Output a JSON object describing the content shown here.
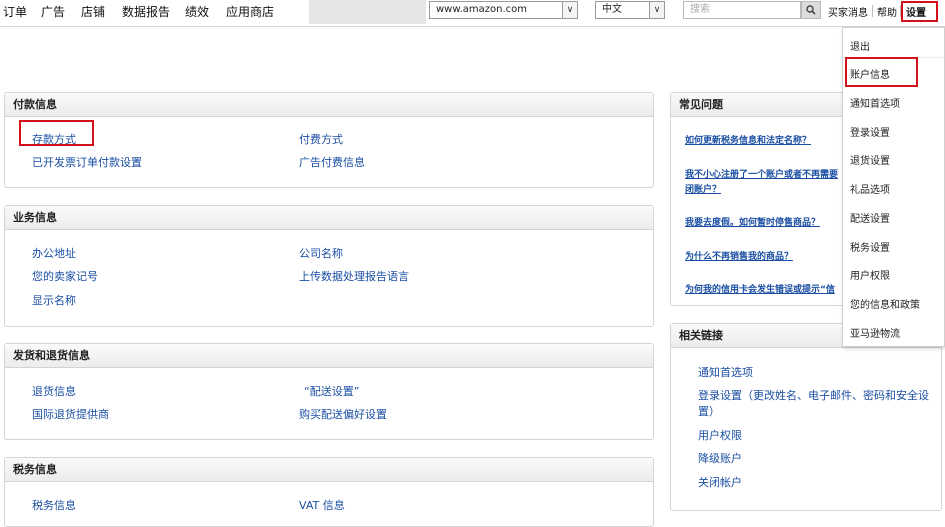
{
  "nav": [
    "订单",
    "广告",
    "店铺",
    "数据报告",
    "绩效",
    "应用商店"
  ],
  "marketplace_select": "www.amazon.com",
  "language_select": "中文",
  "search": {
    "placeholder": "搜索"
  },
  "top_links": {
    "messages": "买家消息",
    "help": "帮助",
    "settings": "设置"
  },
  "payment": {
    "title": "付款信息",
    "links": [
      "存款方式",
      "付费方式",
      "已开发票订单付款设置",
      "广告付费信息"
    ]
  },
  "business": {
    "title": "业务信息",
    "links": [
      "办公地址",
      "公司名称",
      "您的卖家记号",
      "上传数据处理报告语言",
      "显示名称"
    ]
  },
  "shipping": {
    "title": "发货和退货信息",
    "links": [
      "退货信息",
      "“配送设置”",
      "国际退货提供商",
      "购买配送偏好设置"
    ]
  },
  "tax": {
    "title": "税务信息",
    "links": [
      "税务信息",
      "VAT 信息"
    ]
  },
  "faq": {
    "title": "常见问题",
    "items": [
      "如何更新税务信息和法定名称？",
      "我不小心注册了一个账户或者不再需要",
      "闭账户？",
      "我要去度假。如何暂时停售商品？",
      "为什么不再销售我的商品？",
      "为何我的信用卡会发生错误或提示“信"
    ]
  },
  "related": {
    "title": "相关链接",
    "items": [
      "通知首选项",
      "登录设置（更改姓名、电子邮件、密码和安全设",
      "置）",
      "用户权限",
      "降级账户",
      "关闭帐户"
    ]
  },
  "dropdown": [
    "退出",
    "账户信息",
    "通知首选项",
    "登录设置",
    "退货设置",
    "礼品选项",
    "配送设置",
    "税务设置",
    "用户权限",
    "您的信息和政策",
    "亚马逊物流"
  ]
}
